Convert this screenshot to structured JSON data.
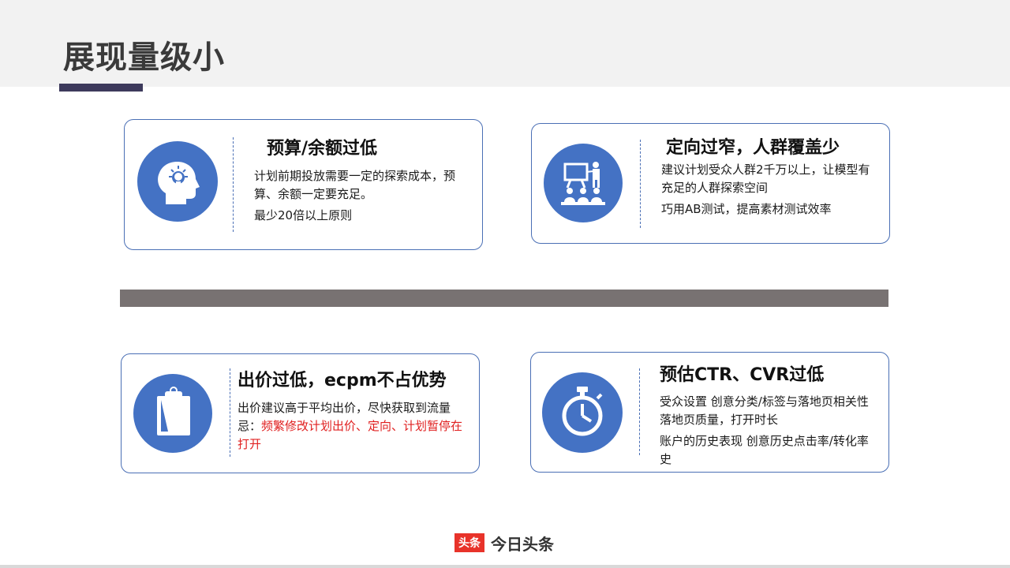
{
  "page": {
    "title": "展现量级小"
  },
  "cards": [
    {
      "title": "预算/余额过低",
      "lines": [
        "计划前期投放需要一定的探索成本，预算、余额一定要充足。",
        "最少20倍以上原则"
      ],
      "icon": "head-lightbulb-icon"
    },
    {
      "title": "定向过窄，人群覆盖少",
      "lines": [
        "建议计划受众人群2千万以上，让模型有充足的人群探索空间",
        "巧用AB测试，提高素材测试效率"
      ],
      "icon": "presentation-audience-icon"
    },
    {
      "title": "出价过低，ecpm不占优势",
      "line1": "出价建议高于平均出价，尽快获取到流量",
      "prefix": "忌：",
      "warning": "频繁修改计划出价、定向、计划暂停在打开",
      "icon": "clipboard-icon"
    },
    {
      "title": "预估CTR、CVR过低",
      "lines": [
        "受众设置 创意分类/标签与落地页相关性 落地页质量，打开时长",
        "账户的历史表现 创意历史点击率/转化率史"
      ],
      "icon": "stopwatch-icon"
    }
  ],
  "footer": {
    "logo_box": "头条",
    "logo_text": "今日头条"
  },
  "colors": {
    "accent": "#4472c4",
    "title_bar": "#3d3a5c",
    "divider": "#787272",
    "warning": "#e02020",
    "logo": "#e8332a"
  }
}
